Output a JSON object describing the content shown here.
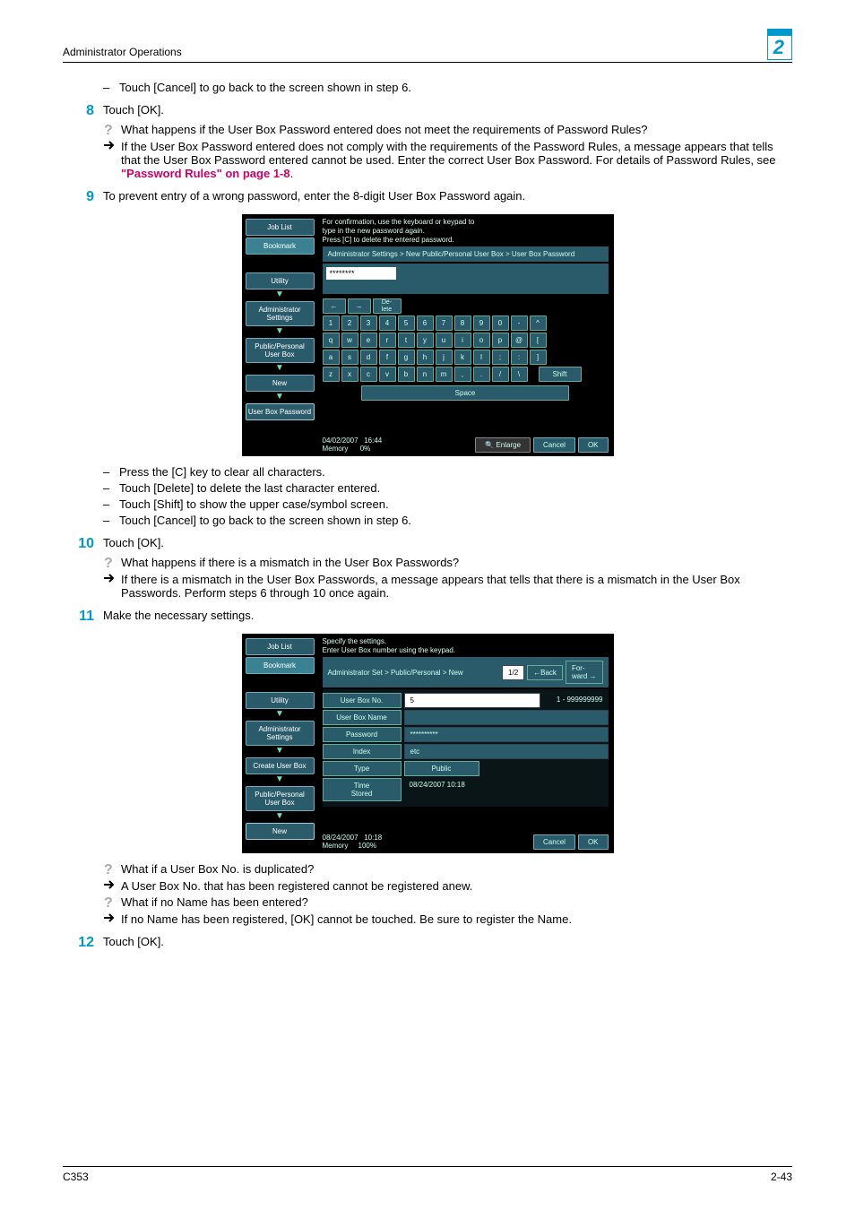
{
  "header": {
    "title": "Administrator Operations",
    "chapter": "2"
  },
  "content": {
    "bullets_pre8": [
      "Touch [Cancel] to go back to the screen shown in step 6."
    ],
    "step8": {
      "num": "8",
      "text": "Touch [OK].",
      "q": "What happens if the User Box Password entered does not meet the requirements of Password Rules?",
      "a_pre": "If the User Box Password entered does not comply with the requirements of the Password Rules, a message appears that tells that the User Box Password entered cannot be used. Enter the correct User Box Password. For details of Password Rules, see ",
      "a_link": "\"Password Rules\" on page 1-8",
      "a_post": "."
    },
    "step9": {
      "num": "9",
      "text": "To prevent entry of a wrong password, enter the 8-digit User Box Password again."
    },
    "screenshot1": {
      "left": [
        "Job List",
        "Bookmark",
        "Utility",
        "Administrator Settings",
        "Public/Personal User Box",
        "New",
        "User Box Password"
      ],
      "instr": "For confirmation, use the keyboard or keypad to\ntype in the new password again.\nPress [C] to delete the entered password.",
      "crumb": "Administrator Settings > New Public/Personal User Box > User Box Password",
      "input": "********",
      "row_arrows": [
        "←",
        "→",
        "De-\nlete"
      ],
      "row1": [
        "1",
        "2",
        "3",
        "4",
        "5",
        "6",
        "7",
        "8",
        "9",
        "0",
        "-",
        "^"
      ],
      "row2": [
        "q",
        "w",
        "e",
        "r",
        "t",
        "y",
        "u",
        "i",
        "o",
        "p",
        "@",
        "["
      ],
      "row3": [
        "a",
        "s",
        "d",
        "f",
        "g",
        "h",
        "j",
        "k",
        "l",
        ";",
        ":",
        "]"
      ],
      "row4": [
        "z",
        "x",
        "c",
        "v",
        "b",
        "n",
        "m",
        ",",
        ".",
        "/",
        "\\"
      ],
      "shift": "Shift",
      "space": "Space",
      "footer_date": "04/02/2007",
      "footer_time": "16:44",
      "footer_mem": "Memory",
      "footer_mem_val": "0%",
      "enlarge": "Enlarge",
      "cancel": "Cancel",
      "ok": "OK"
    },
    "bullets_post9": [
      "Press the [C] key to clear all characters.",
      "Touch [Delete] to delete the last character entered.",
      "Touch [Shift] to show the upper case/symbol screen.",
      "Touch [Cancel] to go back to the screen shown in step 6."
    ],
    "step10": {
      "num": "10",
      "text": "Touch [OK].",
      "q": "What happens if there is a mismatch in the User Box Passwords?",
      "a": "If there is a mismatch in the User Box Passwords, a message appears that tells that there is a mismatch in the User Box Passwords. Perform steps 6 through 10 once again."
    },
    "step11": {
      "num": "11",
      "text": "Make the necessary settings."
    },
    "screenshot2": {
      "left": [
        "Job List",
        "Bookmark",
        "Utility",
        "Administrator Settings",
        "Create User Box",
        "Public/Personal User Box",
        "New"
      ],
      "instr": "Specify the settings.\nEnter User Box number using the keypad.",
      "crumb": "Administrator Set > Public/Personal > New",
      "page": "1/2",
      "back": "←Back",
      "fwd": "For-\nward →",
      "fields": [
        {
          "label": "User Box No.",
          "val": "5",
          "extra": "1 - 999999999",
          "white": true
        },
        {
          "label": "User Box Name",
          "val": ""
        },
        {
          "label": "Password",
          "val": "**********"
        },
        {
          "label": "Index",
          "val": "etc"
        },
        {
          "label": "Type",
          "val": "Public",
          "btn": true
        },
        {
          "label": "Time\nStored",
          "val": "08/24/2007   10:18",
          "plain": true
        }
      ],
      "footer_date": "08/24/2007",
      "footer_time": "10:18",
      "footer_mem": "Memory",
      "footer_mem_val": "100%",
      "cancel": "Cancel",
      "ok": "OK"
    },
    "qa_post11": [
      {
        "q": "What if a User Box No. is duplicated?",
        "a": "A User Box No. that has been registered cannot be registered anew."
      },
      {
        "q": "What if no Name has been entered?",
        "a": "If no Name has been registered, [OK] cannot be touched. Be sure to register the Name."
      }
    ],
    "step12": {
      "num": "12",
      "text": "Touch [OK]."
    }
  },
  "footer": {
    "left": "C353",
    "right": "2-43"
  }
}
